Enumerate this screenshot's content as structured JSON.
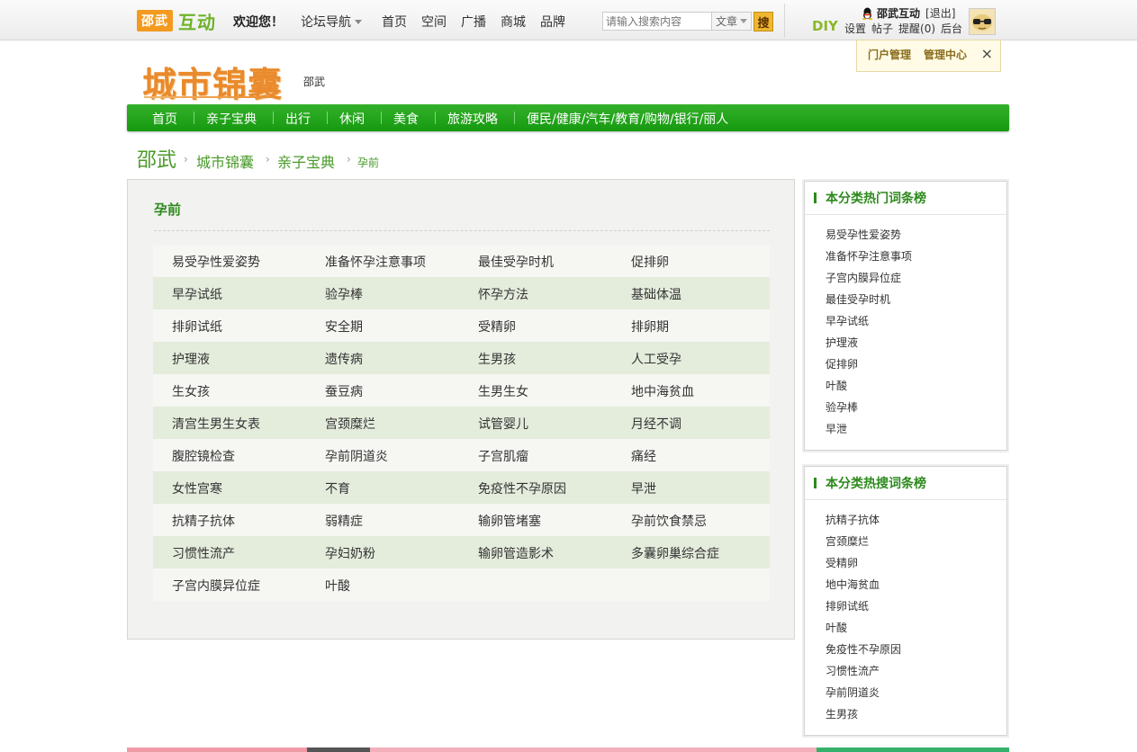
{
  "topbar": {
    "logo_city": "邵武",
    "logo_brand": "互动",
    "welcome": "欢迎您！",
    "forum_nav": "论坛导航",
    "links": [
      "首页",
      "空间",
      "广播",
      "商城",
      "品牌"
    ],
    "search_placeholder": "请输入搜索内容",
    "search_type": "文章",
    "search_button": "搜",
    "diy": "DIY",
    "user_name": "邵武互动",
    "logout": "[退出]",
    "user_links": [
      "设置",
      "帖子",
      "提醒(0)",
      "后台"
    ]
  },
  "admin_popup": {
    "portal_manage": "门户管理",
    "manage_center": "管理中心",
    "close": "×"
  },
  "header": {
    "site_logo": "城市锦囊",
    "city": "邵武"
  },
  "main_nav": [
    "首页",
    "亲子宝典",
    "出行",
    "休闲",
    "美食",
    "旅游攻略",
    "便民/健康/汽车/教育/购物/银行/丽人"
  ],
  "breadcrumb": [
    "邵武",
    "城市锦囊",
    "亲子宝典",
    "孕前"
  ],
  "panel": {
    "title": "孕前",
    "rows": [
      [
        "易受孕性爱姿势",
        "准备怀孕注意事项",
        "最佳受孕时机",
        "促排卵"
      ],
      [
        "早孕试纸",
        "验孕棒",
        "怀孕方法",
        "基础体温"
      ],
      [
        "排卵试纸",
        "安全期",
        "受精卵",
        "排卵期"
      ],
      [
        "护理液",
        "遗传病",
        "生男孩",
        "人工受孕"
      ],
      [
        "生女孩",
        "蚕豆病",
        "生男生女",
        "地中海贫血"
      ],
      [
        "清宫生男生女表",
        "宫颈糜烂",
        "试管婴儿",
        "月经不调"
      ],
      [
        "腹腔镜检查",
        "孕前阴道炎",
        "子宫肌瘤",
        "痛经"
      ],
      [
        "女性宫寒",
        "不育",
        "免疫性不孕原因",
        "早泄"
      ],
      [
        "抗精子抗体",
        "弱精症",
        "输卵管堵塞",
        "孕前饮食禁忌"
      ],
      [
        "习惯性流产",
        "孕妇奶粉",
        "输卵管造影术",
        "多囊卵巢综合症"
      ],
      [
        "子宫内膜异位症",
        "叶酸",
        "",
        ""
      ]
    ]
  },
  "sidebar": {
    "hot_title": "本分类热门词条榜",
    "hot_items": [
      "易受孕性爱姿势",
      "准备怀孕注意事项",
      "子宫内膜异位症",
      "最佳受孕时机",
      "早孕试纸",
      "护理液",
      "促排卵",
      "叶酸",
      "验孕棒",
      "早泄"
    ],
    "search_title": "本分类热搜词条榜",
    "search_items": [
      "抗精子抗体",
      "宫颈糜烂",
      "受精卵",
      "地中海贫血",
      "排卵试纸",
      "叶酸",
      "免疫性不孕原因",
      "习惯性流产",
      "孕前阴道炎",
      "生男孩"
    ]
  }
}
